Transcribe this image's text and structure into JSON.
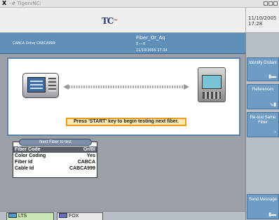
{
  "window": {
    "title_glyph": "X",
    "title": "-# TigervNC:"
  },
  "header": {
    "logo_text": "TC",
    "logo_accent": "~",
    "date": "11/10/2005",
    "time": "17:28"
  },
  "info": {
    "cable_info": "CABCA  Orlnq  CABCA999",
    "title": "Fiber_Or_Aq",
    "line2": "0 -- 0",
    "line3": "11/10/2005  17:34"
  },
  "main": {
    "start_message": "Press 'START' key to begin testing next fiber."
  },
  "test_panel": {
    "title": "Next Fiber to test",
    "rows": [
      {
        "key": "Fiber Code",
        "value": "Or/Bl"
      },
      {
        "key": "Color Coding",
        "value": "Yes"
      },
      {
        "key": "Fiber Id",
        "value": "CABCA"
      },
      {
        "key": "Cable Id",
        "value": "CABCA999"
      }
    ]
  },
  "side_buttons": {
    "identify_distant": "Identify Distant",
    "references": "References",
    "retest_same_fiber": "Re-test Same Fiber",
    "send_message": "Send Message"
  },
  "tabs": {
    "lts": "LTS",
    "fox": "FOX"
  },
  "colors": {
    "accent_blue": "#5e8fb8",
    "message_border": "#f09a1a",
    "message_fill": "#fde9b0",
    "side_button": "#6f9cc4"
  }
}
